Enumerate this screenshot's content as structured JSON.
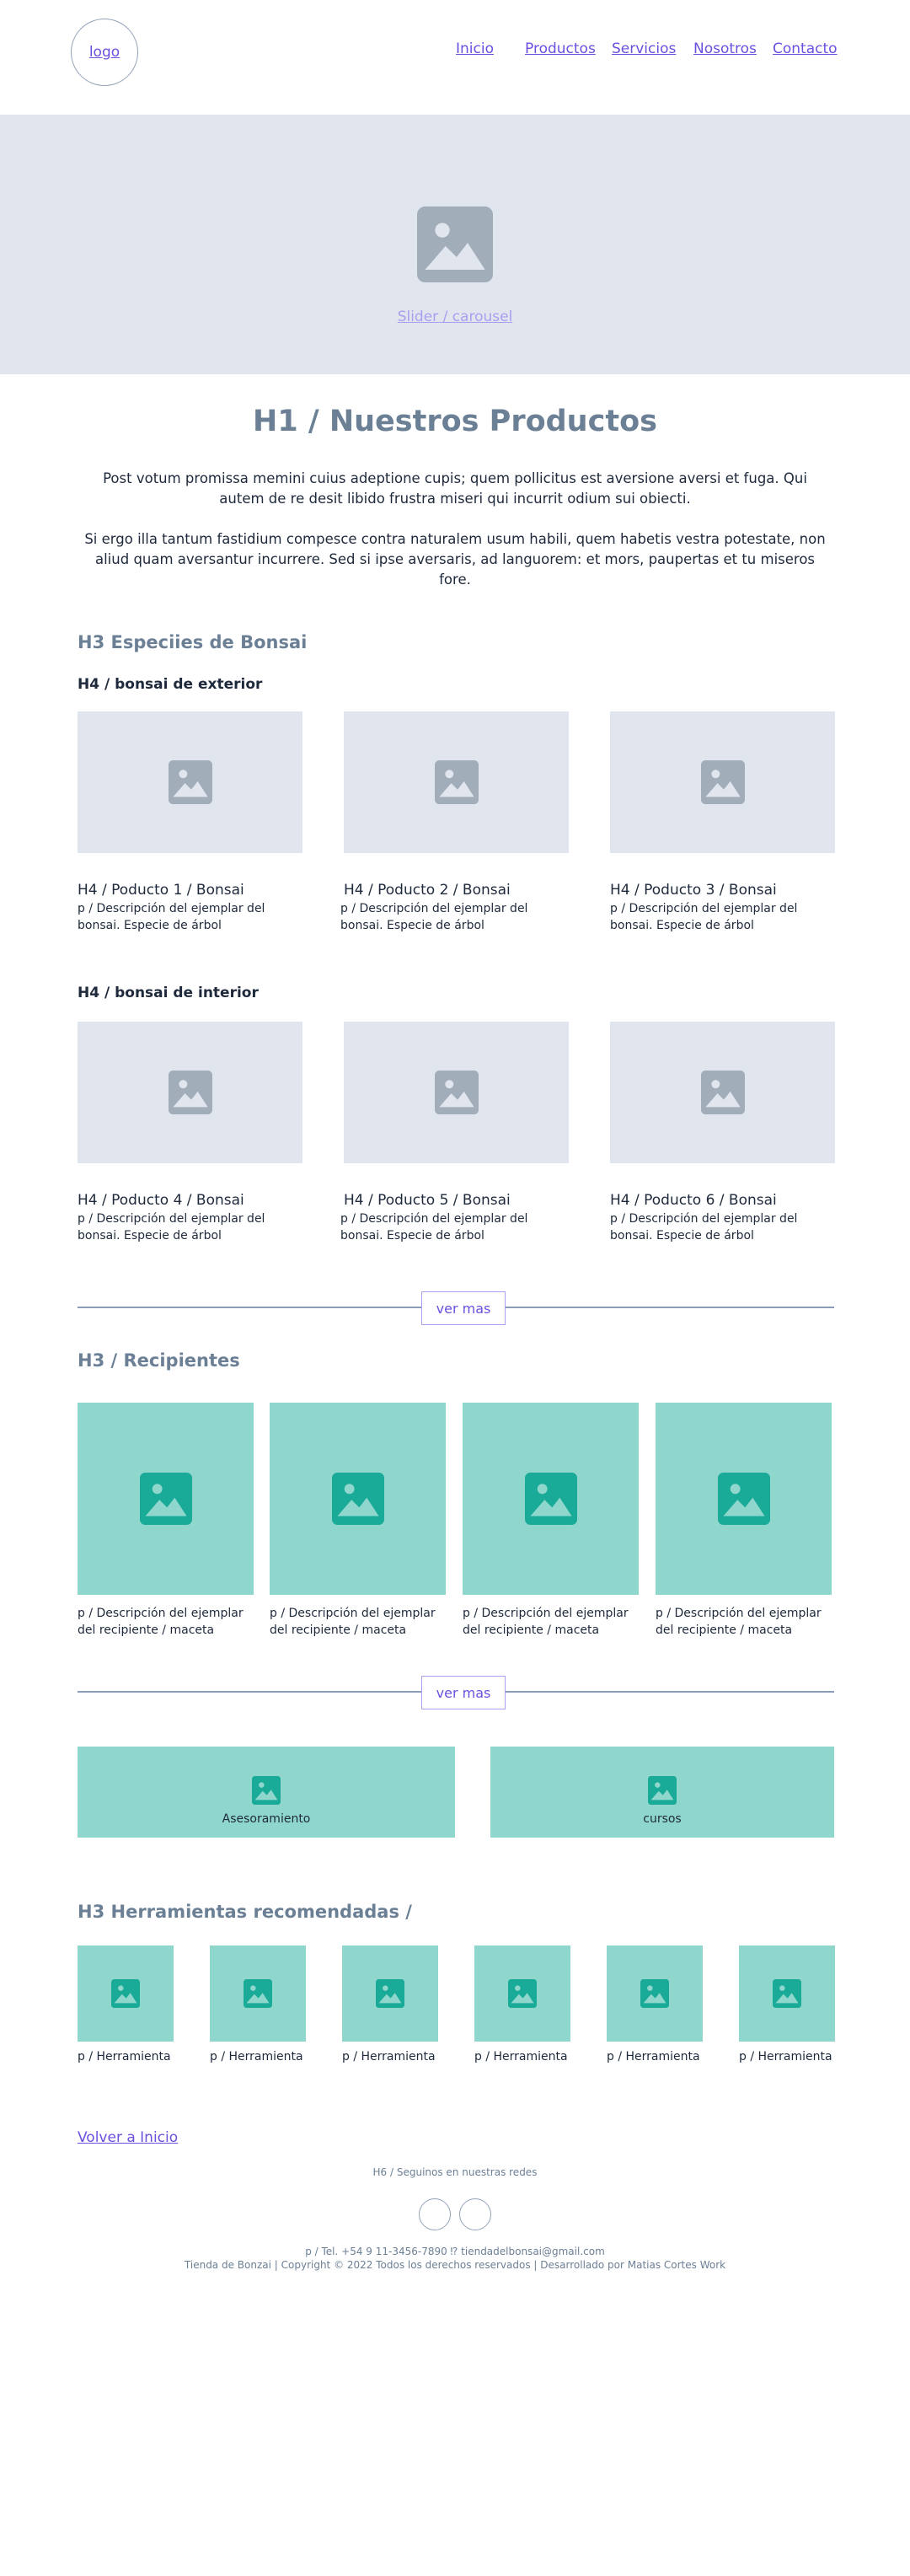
{
  "header": {
    "logo": "logo",
    "nav": [
      "Inicio",
      "Productos",
      "Servicios",
      "Nosotros",
      "Contacto"
    ]
  },
  "hero": {
    "caption": "Slider / carousel"
  },
  "intro": {
    "title": "H1 / Nuestros Productos",
    "p1": "Post votum promissa memini cuius adeptione cupis; quem pollicitus est aversione aversi et fuga. Qui autem de re desit libido frustra miseri qui incurrit odium sui obiecti.",
    "p2": "Si ergo illa tantum fastidium compesce contra naturalem usum habili, quem habetis vestra potestate, non aliud quam aversantur incurrere. Sed si ipse aversaris, ad languorem: et mors, paupertas et tu miseros fore."
  },
  "bonsai": {
    "title": "H3 Especiies de Bonsai",
    "exterior_title": "H4 / bonsai de exterior",
    "interior_title": "H4 / bonsai de interior",
    "products": [
      {
        "title": "H4 / Poducto 1 / Bonsai",
        "desc": "p / Descripción del ejemplar del bonsai. Especie de árbol"
      },
      {
        "title": "H4 / Poducto 2 / Bonsai",
        "desc": "p / Descripción del ejemplar del bonsai. Especie de árbol"
      },
      {
        "title": "H4 / Poducto 3 / Bonsai",
        "desc": "p / Descripción del ejemplar del bonsai. Especie de árbol"
      },
      {
        "title": "H4 / Poducto 4 / Bonsai",
        "desc": "p / Descripción del ejemplar del bonsai. Especie de árbol"
      },
      {
        "title": "H4 / Poducto 5 / Bonsai",
        "desc": "p / Descripción del ejemplar del bonsai. Especie de árbol"
      },
      {
        "title": "H4 / Poducto 6 / Bonsai",
        "desc": "p / Descripción del ejemplar del bonsai. Especie de árbol"
      }
    ],
    "ver_mas": "ver mas"
  },
  "recipientes": {
    "title": "H3 / Recipientes",
    "items": [
      "p / Descripción del ejemplar del recipiente / maceta",
      "p / Descripción del ejemplar del recipiente / maceta",
      "p / Descripción del ejemplar del recipiente / maceta",
      "p / Descripción del ejemplar del recipiente / maceta"
    ],
    "ver_mas": "ver mas"
  },
  "services": [
    "Asesoramiento",
    "cursos"
  ],
  "tools": {
    "title": "H3 Herramientas recomendadas /",
    "items": [
      "p / Herramienta",
      "p / Herramienta",
      "p / Herramienta",
      "p / Herramienta",
      "p / Herramienta",
      "p / Herramienta"
    ]
  },
  "footer": {
    "back": "Volver a Inicio",
    "social_title": "H6 / Seguinos en nuestras redes",
    "contact": "p / Tel. +54 9 11-3456-7890 ⁉ tiendadelbonsai@gmail.com",
    "copyright": "Tienda de Bonzai | Copyright © 2022 Todos los derechos reservados | Desarrollado por Matias Cortes Work"
  },
  "colors": {
    "accent": "#6d4fe0",
    "placeholder_grey": "#e1e6ee",
    "placeholder_teal": "#8fd7cd",
    "icon_teal": "#1aaa98",
    "heading_grey": "#6b7f95"
  }
}
